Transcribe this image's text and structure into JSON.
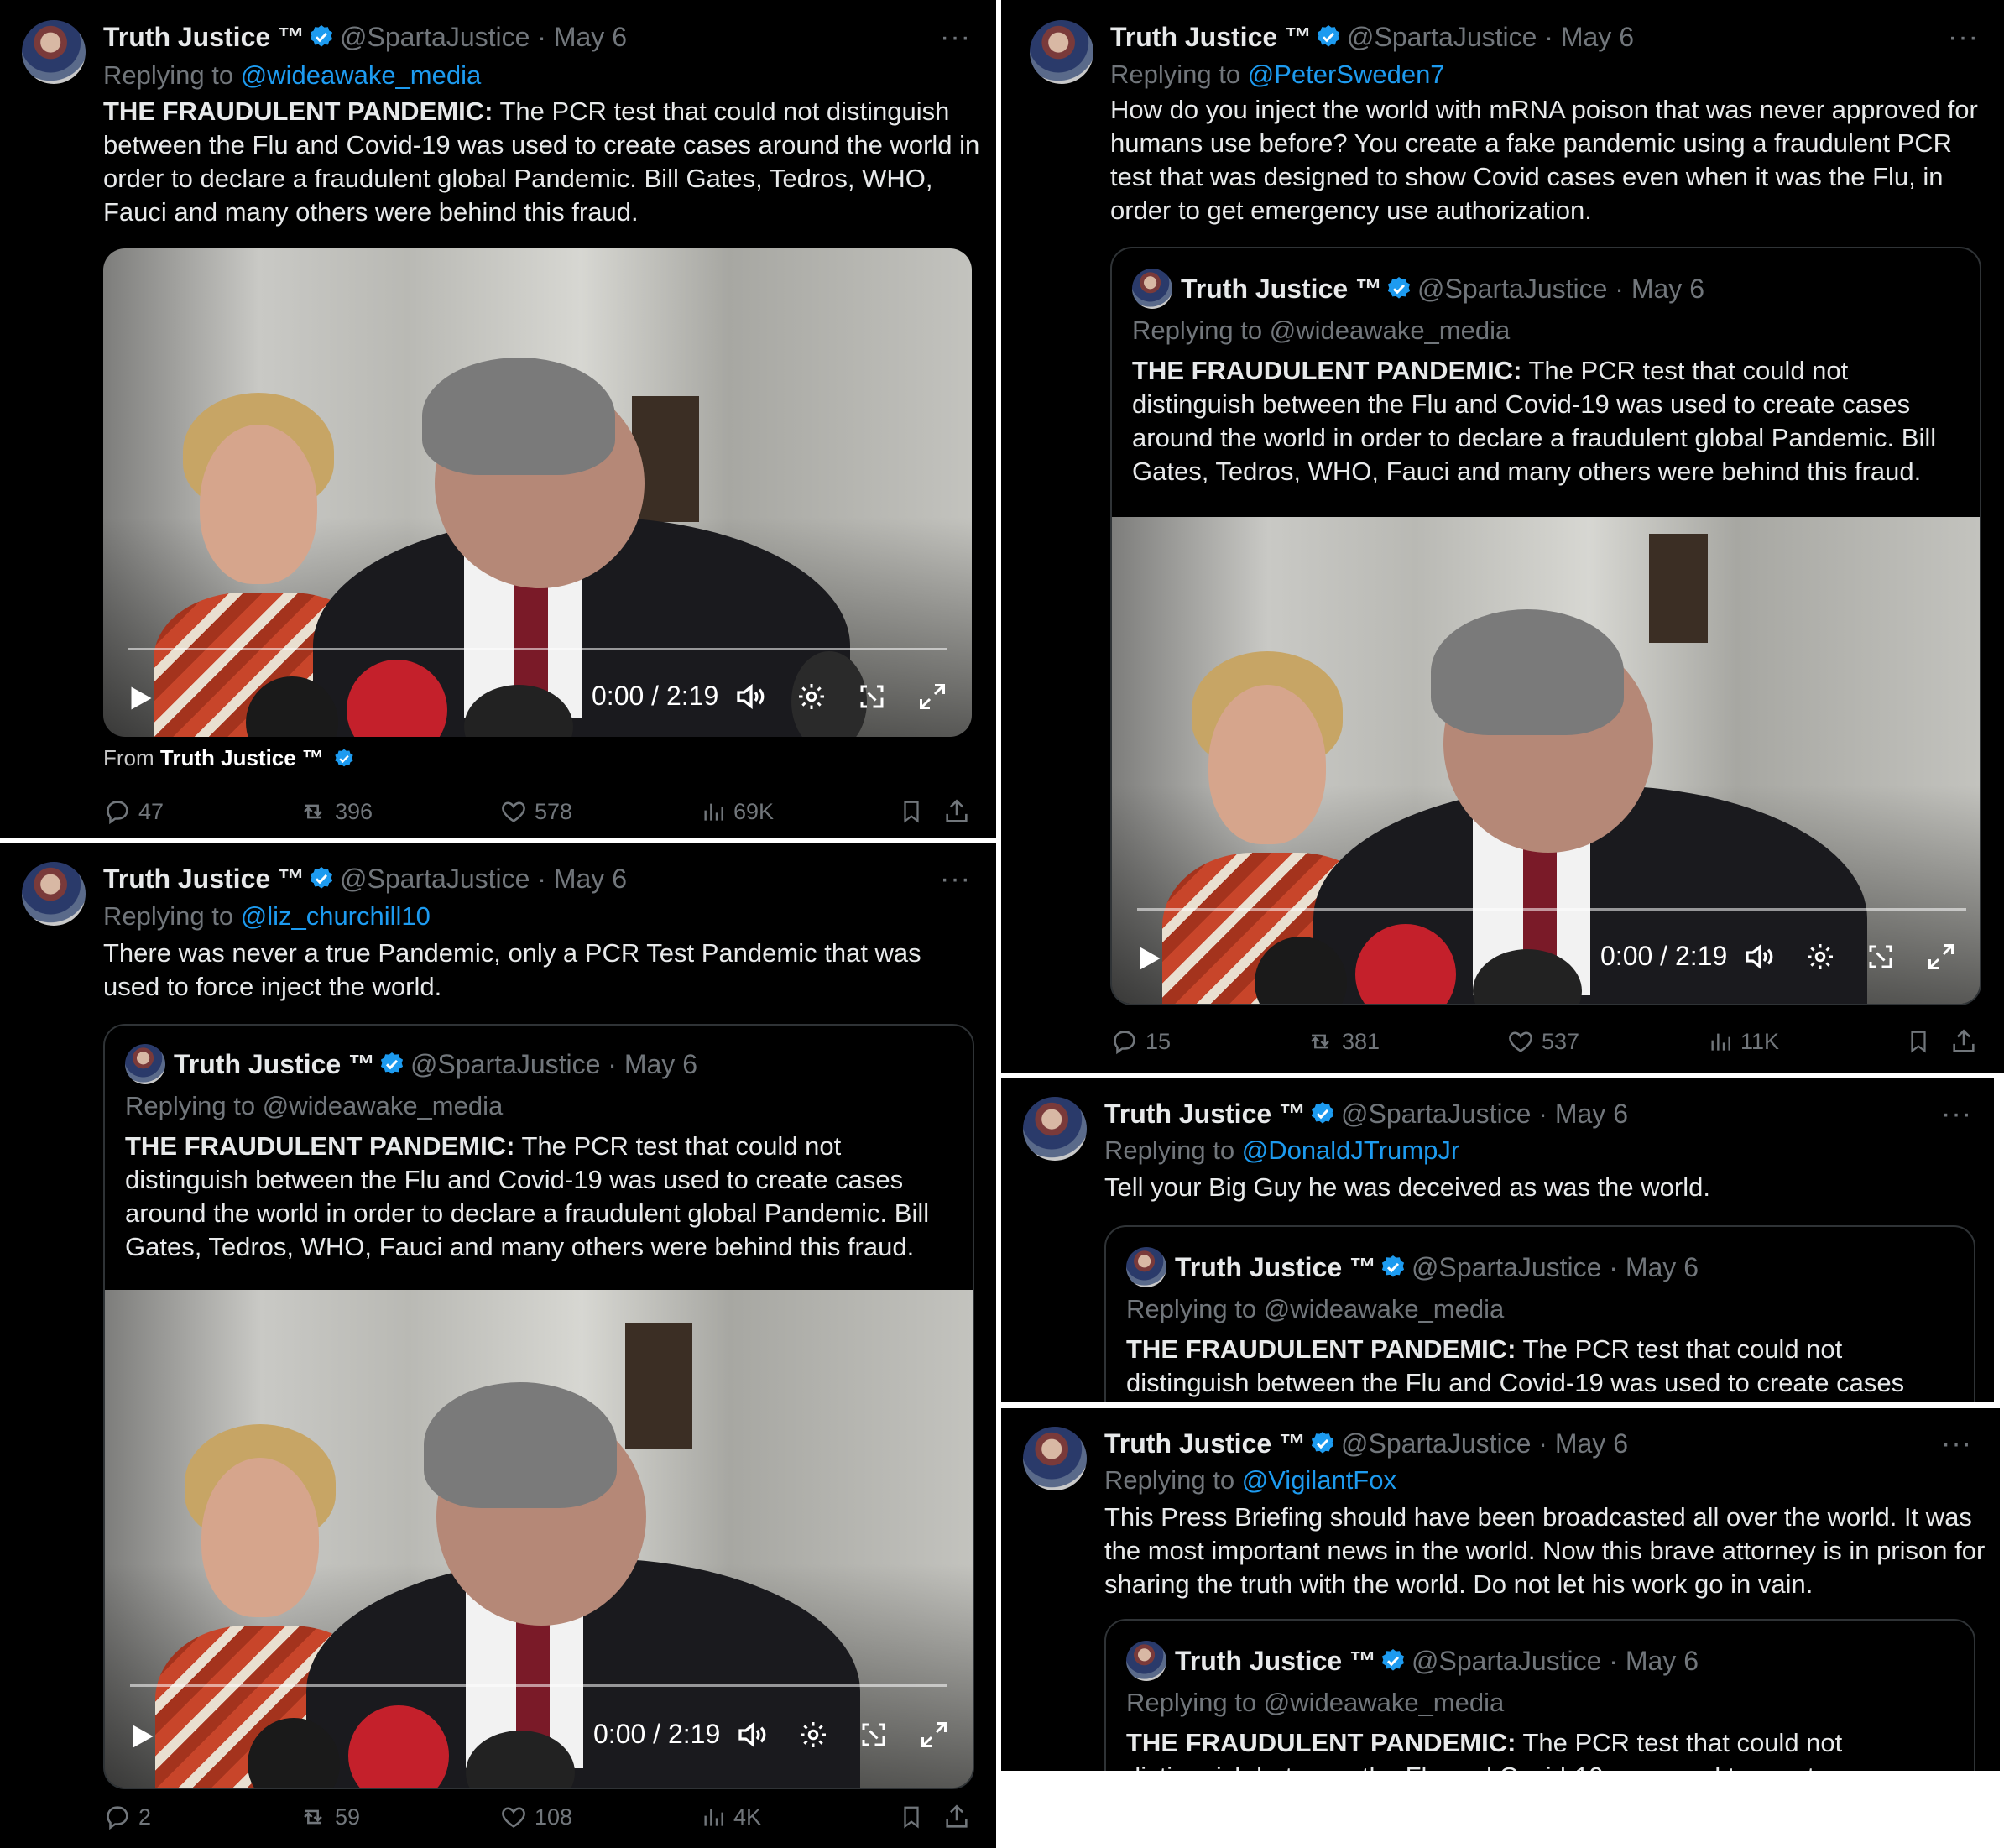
{
  "colors": {
    "background": "#000000",
    "text": "#e7e9ea",
    "muted": "#71767b",
    "link": "#1d9bf0",
    "verified": "#1d9bf0"
  },
  "author": {
    "name": "Truth Justice ™",
    "handle": "@SpartaJustice",
    "dot": "·",
    "date": "May 6"
  },
  "quoted": {
    "name": "Truth Justice ™",
    "handle": "@SpartaJustice",
    "dot": "·",
    "date": "May 6",
    "reply_prefix": "Replying to",
    "reply_to": "@wideawake_media",
    "lead": "THE FRAUDULENT PANDEMIC:",
    "text": " The PCR test that could not distinguish between the Flu and Covid-19 was used to create cases around the world in order to declare a fraudulent global Pandemic. Bill Gates, Tedros, WHO, Fauci and many others were behind this fraud."
  },
  "video": {
    "time": "0:00 / 2:19"
  },
  "tweets": [
    {
      "reply_prefix": "Replying to",
      "reply_to": "@wideawake_media",
      "lead": "THE FRAUDULENT PANDEMIC:",
      "text": " The PCR test that could not distinguish between the Flu and Covid-19 was used to create cases around the world in order to declare a fraudulent global Pandemic. Bill Gates, Tedros, WHO, Fauci and many others were behind this fraud.",
      "from_prefix": "From",
      "from_name": "Truth Justice ™",
      "stats": {
        "replies": "47",
        "reposts": "396",
        "likes": "578",
        "views": "69K"
      }
    },
    {
      "reply_prefix": "Replying to",
      "reply_to": "@liz_churchill10",
      "text": "There was never a true Pandemic, only a PCR Test Pandemic that was used to force inject the world.",
      "stats": {
        "replies": "2",
        "reposts": "59",
        "likes": "108",
        "views": "4K"
      }
    },
    {
      "reply_prefix": "Replying to",
      "reply_to": "@PeterSweden7",
      "text": "How do you inject the world with mRNA poison that was never approved for humans use before? You create a fake pandemic using a fraudulent PCR test that was designed to show Covid cases even when it was the Flu, in order to get emergency use authorization.",
      "stats": {
        "replies": "15",
        "reposts": "381",
        "likes": "537",
        "views": "11K"
      }
    },
    {
      "reply_prefix": "Replying to",
      "reply_to": "@DonaldJTrumpJr",
      "text": "Tell your Big Guy he was deceived as was the world.",
      "quote_visible": "distinguish between the Flu and Covid-19 was used to create cases"
    },
    {
      "reply_prefix": "Replying to",
      "reply_to": "@VigilantFox",
      "text": "This Press Briefing should have been broadcasted all over the world. It was the most important news in the world. Now this brave attorney is in prison for sharing the truth with the world. Do not let his work go in vain."
    }
  ]
}
